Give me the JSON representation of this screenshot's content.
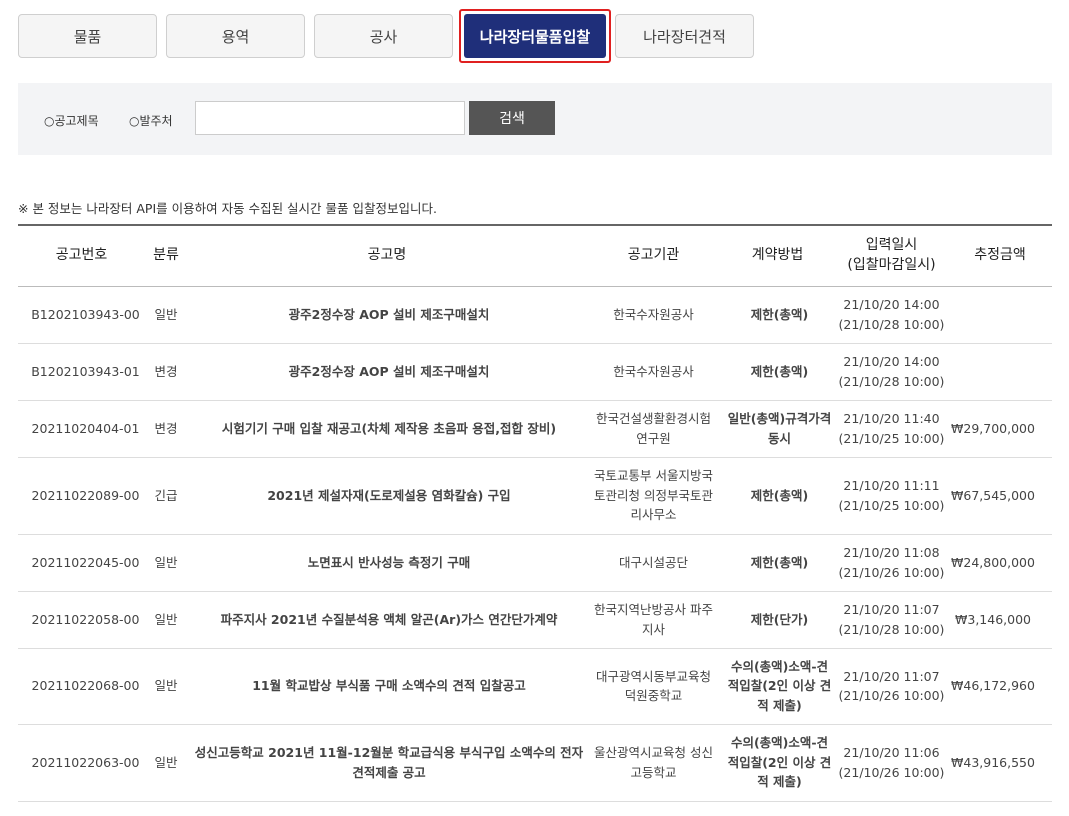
{
  "tabs": [
    {
      "label": "물품"
    },
    {
      "label": "용역"
    },
    {
      "label": "공사"
    },
    {
      "label": "나라장터물품입찰"
    },
    {
      "label": "나라장터견적"
    }
  ],
  "active_tab_color": "#1f2f7a",
  "highlight_color": "#e02020",
  "search": {
    "radio_title": "○공고제목",
    "radio_org": "○발주처",
    "input_value": "",
    "button_label": "검색"
  },
  "notice": "※ 본 정보는 나라장터 API를 이용하여 자동 수집된 실시간 물품 입찰정보입니다.",
  "table": {
    "headers": {
      "no": "공고번호",
      "type": "분류",
      "title": "공고명",
      "org": "공고기관",
      "method": "계약방법",
      "date_1": "입력일시",
      "date_2": "(입찰마감일시)",
      "price": "추정금액"
    },
    "rows": [
      {
        "no": "B1202103943-00",
        "type": "일반",
        "title": "광주2정수장 AOP 설비 제조구매설치",
        "org": [
          "한국수자원공사"
        ],
        "method": [
          "제한(총액)"
        ],
        "input_date": "21/10/20 14:00",
        "close_date": "(21/10/28 10:00)",
        "price": ""
      },
      {
        "no": "B1202103943-01",
        "type": "변경",
        "title": "광주2정수장 AOP 설비 제조구매설치",
        "org": [
          "한국수자원공사"
        ],
        "method": [
          "제한(총액)"
        ],
        "input_date": "21/10/20 14:00",
        "close_date": "(21/10/28 10:00)",
        "price": ""
      },
      {
        "no": "20211020404-01",
        "type": "변경",
        "title": "시험기기 구매 입찰 재공고(차체 제작용 초음파 용접,접합 장비)",
        "org": [
          "한국건설생활환경시험",
          "연구원"
        ],
        "method": [
          "일반(총액)규격가격",
          "동시"
        ],
        "input_date": "21/10/20 11:40",
        "close_date": "(21/10/25 10:00)",
        "price": "₩29,700,000"
      },
      {
        "no": "20211022089-00",
        "type": "긴급",
        "title": "2021년 제설자재(도로제설용 염화칼슘) 구입",
        "org": [
          "국토교통부 서울지방국",
          "토관리청 의정부국토관",
          "리사무소"
        ],
        "method": [
          "제한(총액)"
        ],
        "input_date": "21/10/20 11:11",
        "close_date": "(21/10/25 10:00)",
        "price": "₩67,545,000"
      },
      {
        "no": "20211022045-00",
        "type": "일반",
        "title": "노면표시 반사성능 측정기 구매",
        "org": [
          "대구시설공단"
        ],
        "method": [
          "제한(총액)"
        ],
        "input_date": "21/10/20 11:08",
        "close_date": "(21/10/26 10:00)",
        "price": "₩24,800,000"
      },
      {
        "no": "20211022058-00",
        "type": "일반",
        "title": "파주지사 2021년 수질분석용 액체 알곤(Ar)가스 연간단가계약",
        "org": [
          "한국지역난방공사 파주",
          "지사"
        ],
        "method": [
          "제한(단가)"
        ],
        "input_date": "21/10/20 11:07",
        "close_date": "(21/10/28 10:00)",
        "price": "₩3,146,000"
      },
      {
        "no": "20211022068-00",
        "type": "일반",
        "title": "11월 학교밥상 부식품 구매 소액수의 견적 입찰공고",
        "org": [
          "대구광역시동부교육청",
          "덕원중학교"
        ],
        "method": [
          "수의(총액)소액-견",
          "적입찰(2인 이상 견",
          "적 제출)"
        ],
        "input_date": "21/10/20 11:07",
        "close_date": "(21/10/26 10:00)",
        "price": "₩46,172,960"
      },
      {
        "no": "20211022063-00",
        "type": "일반",
        "title": "성신고등학교 2021년 11월-12월분 학교급식용 부식구입 소액수의 전자견적제출 공고",
        "org": [
          "울산광역시교육청 성신",
          "고등학교"
        ],
        "method": [
          "수의(총액)소액-견",
          "적입찰(2인 이상 견",
          "적 제출)"
        ],
        "input_date": "21/10/20 11:06",
        "close_date": "(21/10/26 10:00)",
        "price": "₩43,916,550"
      }
    ]
  }
}
